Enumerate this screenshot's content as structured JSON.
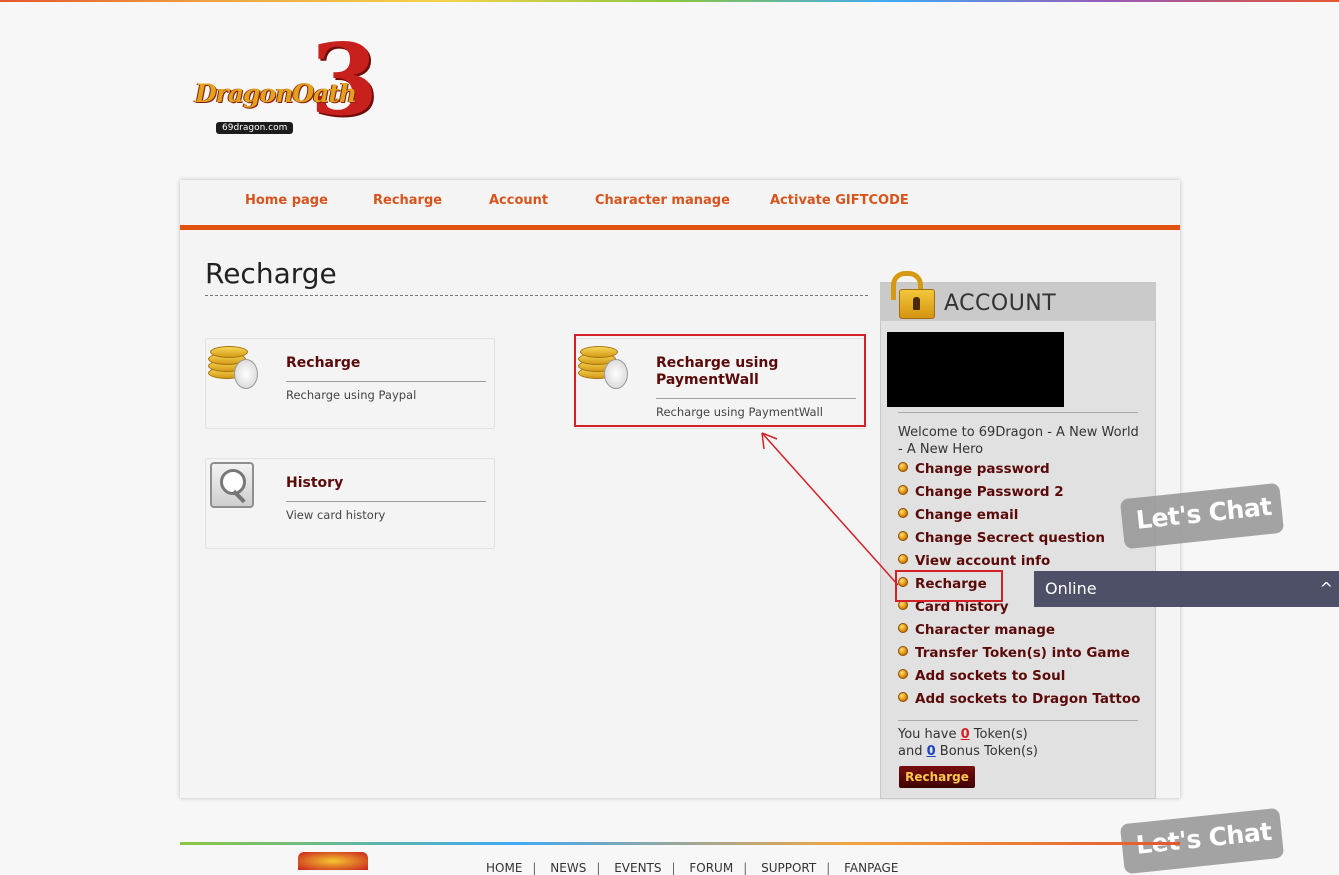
{
  "logo": {
    "text": "DragonOath",
    "number": "3",
    "site": "69dragon.com"
  },
  "nav": [
    "Home page",
    "Recharge",
    "Account",
    "Character manage",
    "Activate GIFTCODE"
  ],
  "page": {
    "title": "Recharge"
  },
  "options": [
    {
      "title": "Recharge",
      "subtitle": "Recharge using Paypal",
      "icon": "coins-icon"
    },
    {
      "title": "Recharge using PaymentWall",
      "subtitle": "Recharge using PaymentWall",
      "icon": "coins-icon"
    },
    {
      "title": "History",
      "subtitle": "View card history",
      "icon": "magnifier-icon"
    }
  ],
  "account": {
    "heading": "ACCOUNT",
    "welcome": "Welcome to 69Dragon - A New World - A New Hero",
    "menu": [
      "Change password",
      "Change Password 2",
      "Change email",
      "Change Secrect question",
      "View account info",
      "Recharge",
      "Card history",
      "Character manage",
      "Transfer Token(s) into Game",
      "Add sockets to Soul",
      "Add sockets to Dragon Tattoo"
    ],
    "tokens": {
      "prefix": "You have",
      "count": "0",
      "unit": "Token(s)",
      "and": "and",
      "bonus_count": "0",
      "bonus_unit": "Bonus Token(s)"
    },
    "recharge_button": "Recharge"
  },
  "chat": {
    "bubble": "Let's Chat",
    "status": "Online",
    "chevron": "^"
  },
  "footer": {
    "links": [
      "HOME",
      "NEWS",
      "EVENTS",
      "FORUM",
      "SUPPORT",
      "FANPAGE"
    ],
    "separator": "|"
  },
  "colors": {
    "accent": "#e1510f",
    "link": "#d9531c",
    "item": "#5b0a0a",
    "highlight": "#d42027"
  }
}
